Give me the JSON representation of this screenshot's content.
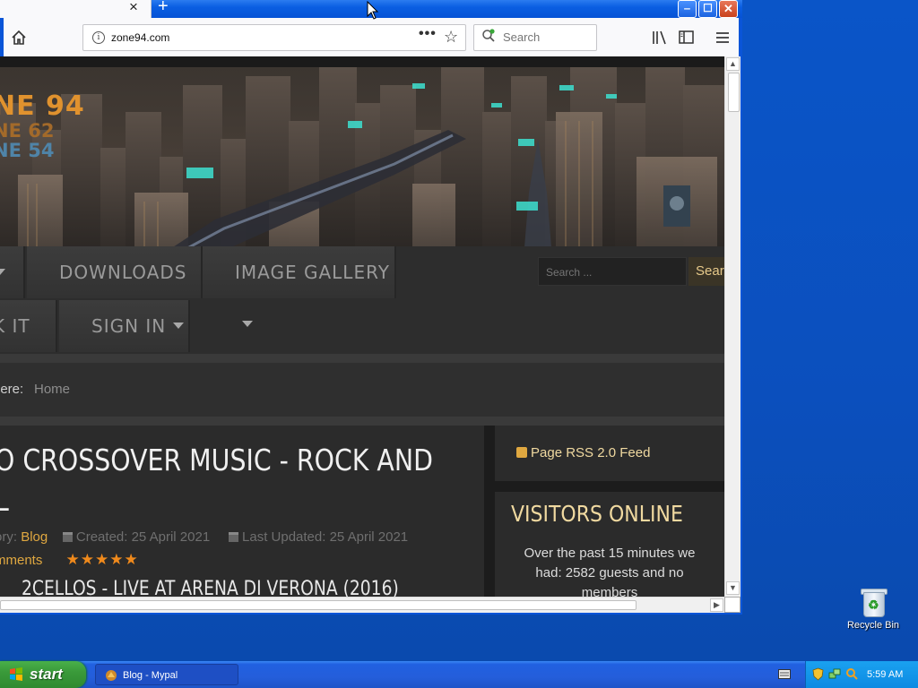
{
  "browser": {
    "new_tab_symbol": "+",
    "tab_close_symbol": "×",
    "url": "zone94.com",
    "search_placeholder": "Search",
    "window_buttons": {
      "minimize": "‒",
      "maximize": "☐",
      "close": "✕"
    }
  },
  "site": {
    "logo": {
      "line1": "NE 94",
      "line2": "NE 62",
      "line3": "NE 54"
    },
    "nav": {
      "downloads": "DOWNLOADS",
      "image_gallery": "IMAGE GALLERY",
      "kit": "K IT",
      "sign_in": "SIGN IN"
    },
    "search_placeholder": "Search ...",
    "search_button": "Sear",
    "breadcrumb": {
      "label": "here:",
      "home": "Home"
    },
    "article": {
      "title_line1": "O CROSSOVER MUSIC - ROCK AND",
      "title_line2": "L",
      "category_label": "ory:",
      "category": "Blog",
      "created": "Created: 25 April 2021",
      "updated": "Last Updated: 25 April 2021",
      "comments": "mments",
      "stars": "★★★★★",
      "subtitle": "2CELLOS - LIVE AT ARENA DI VERONA (2016)"
    },
    "rss": "Page RSS 2.0 Feed",
    "visitors": {
      "heading": "VISITORS ONLINE",
      "text": "Over the past 15 minutes we had: 2582 guests and no members"
    }
  },
  "desktop": {
    "recycle_bin": "Recycle Bin"
  },
  "taskbar": {
    "start": "start",
    "task": "Blog - Mypal",
    "clock": "5:59 AM"
  }
}
